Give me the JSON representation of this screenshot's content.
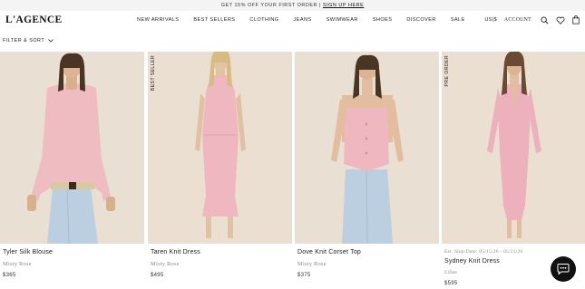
{
  "promo": {
    "text": "GET 15% OFF YOUR FIRST ORDER",
    "separator": "|",
    "link": "SIGN UP HERE"
  },
  "header": {
    "logo": "L'AGENCE",
    "nav": [
      "NEW ARRIVALS",
      "BEST SELLERS",
      "CLOTHING",
      "JEANS",
      "SWIMWEAR",
      "SHOES",
      "DISCOVER",
      "SALE"
    ],
    "currency": "US|$",
    "account": "ACCOUNT",
    "icons": [
      "search-icon",
      "heart-icon",
      "bag-icon"
    ]
  },
  "filter": {
    "label": "FILTER & SORT"
  },
  "products": [
    {
      "name": "Tyler Silk Blouse",
      "color": "Misty Rose",
      "price": "$365",
      "badge": "",
      "ship": ""
    },
    {
      "name": "Taren Knit Dress",
      "color": "Misty Rose",
      "price": "$495",
      "badge": "BEST SELLER",
      "ship": ""
    },
    {
      "name": "Dove Knit Corset Top",
      "color": "Misty Rose",
      "price": "$375",
      "badge": "",
      "ship": ""
    },
    {
      "name": "Sydney Knit Dress",
      "color": "Lilas",
      "price": "$595",
      "badge": "PRE ORDER",
      "ship": "Est. Ship Date: 05/15/26 - 05/21/26"
    }
  ],
  "colors": {
    "background": "#ffffff",
    "promo_bg": "#f4f4f4",
    "photo_bg": "#e9ddd1",
    "pink": "#efb7c0",
    "denim": "#b9cfe2",
    "chat": "#111111"
  }
}
